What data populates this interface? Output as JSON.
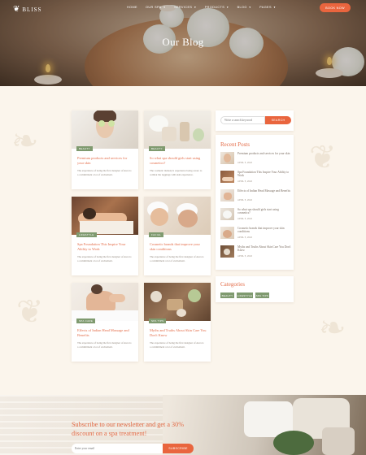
{
  "brand": {
    "logo": "BLISS",
    "logo_icon": "lotus-icon"
  },
  "nav": {
    "items": [
      {
        "label": "HOME"
      },
      {
        "label": "OUR SPA"
      },
      {
        "label": "SERVICES"
      },
      {
        "label": "PRODUCTS"
      },
      {
        "label": "BLOG"
      },
      {
        "label": "PAGES"
      }
    ],
    "cta": "BOOK NOW"
  },
  "hero": {
    "title": "Our Blog"
  },
  "posts": [
    {
      "tag": "BEAUTY",
      "title": "Premium products and services for your skin",
      "excerpt": "The experience of being the first designer of Aura is a commitment a lot of excitement."
    },
    {
      "tag": "BEAUTY",
      "title": "So what spa should girls start using cosmetics?",
      "excerpt": "The cosmetic industry's experience being aware to combat the leggings with skin experience."
    },
    {
      "tag": "LIFESTYLE",
      "title": "Spa Foundation This Inspire Your Ability to Work",
      "excerpt": "The experience of being the first designer of Aura is a commitment a lot of excitement."
    },
    {
      "tag": "FACIAL",
      "title": "Cosmetic brands that improve your skin conditions",
      "excerpt": "The experience of being the first designer of Aura is a commitment a lot of excitement."
    },
    {
      "tag": "SPA CARE",
      "title": "Effects of Indian Head Massage and Benefits",
      "excerpt": "The experience of being the first designer of Aura is a commitment a lot of excitement."
    },
    {
      "tag": "SPA TIPS",
      "title": "Myths and Truths About Skin Care You Don't Know",
      "excerpt": "The experience of being the first designer of Aura is a commitment a lot of excitement."
    }
  ],
  "sidebar": {
    "search": {
      "placeholder": "Write a search keyword",
      "button": "SEARCH"
    },
    "recent_heading": "Recent Posts",
    "recent": [
      {
        "title": "Premium products and services for your skin",
        "date": "APRIL 5, 2022"
      },
      {
        "title": "Spa Foundation This Inspire Your Ability to Work",
        "date": "APRIL 5, 2022"
      },
      {
        "title": "Effects of Indian Head Massage and Benefits",
        "date": "APRIL 5, 2022"
      },
      {
        "title": "So what spa should girls start using cosmetics?",
        "date": "APRIL 5, 2022"
      },
      {
        "title": "Cosmetic brands that improve your skin conditions",
        "date": "APRIL 5, 2022"
      },
      {
        "title": "Myths and Truths About Skin Care You Don't Know",
        "date": "APRIL 5, 2022"
      }
    ],
    "categories_heading": "Categories",
    "categories": [
      "BEAUTY",
      "LIFESTYLE",
      "SPA TIPS"
    ]
  },
  "newsletter": {
    "title": "Subscribe to our newsletter and get a 30% discount on a spa treatment!",
    "placeholder": "Enter your email",
    "button": "SUBSCRIBE"
  },
  "colors": {
    "accent": "#e9653e",
    "tag_green": "#7f9a6f",
    "page_bg": "#fbf5ec"
  }
}
